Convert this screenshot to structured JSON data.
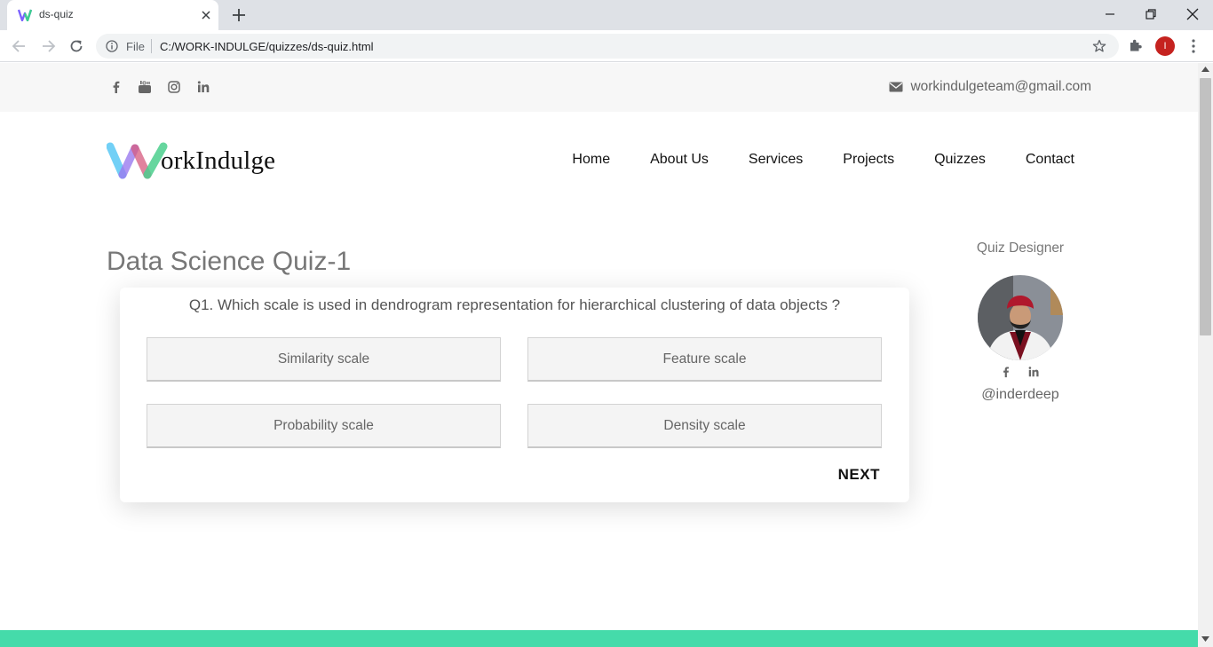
{
  "browser": {
    "tab_title": "ds-quiz",
    "url_scheme_label": "File",
    "url": "C:/WORK-INDULGE/quizzes/ds-quiz.html",
    "profile_initial": "I"
  },
  "topbar": {
    "social_icons": [
      "facebook-icon",
      "youtube-icon",
      "instagram-icon",
      "linkedin-icon"
    ],
    "email": "workindulgeteam@gmail.com"
  },
  "brand": {
    "logo_text": "orkIndulge",
    "logo_colors": [
      "#5ac8f5",
      "#9b7bf0",
      "#4ccf8e",
      "#d65a7e"
    ]
  },
  "nav": {
    "items": [
      "Home",
      "About Us",
      "Services",
      "Projects",
      "Quizzes",
      "Contact"
    ]
  },
  "quiz": {
    "title": "Data Science Quiz-1",
    "question": "Q1. Which scale is used in dendrogram representation for hierarchical clustering of data objects ?",
    "options": [
      "Similarity scale",
      "Feature scale",
      "Probability scale",
      "Density scale"
    ],
    "next_label": "NEXT"
  },
  "designer": {
    "label": "Quiz Designer",
    "handle": "@inderdeep",
    "social_icons": [
      "facebook-icon",
      "linkedin-icon"
    ]
  },
  "colors": {
    "footer_accent": "#45dbaa",
    "profile_avatar": "#c5221f"
  }
}
